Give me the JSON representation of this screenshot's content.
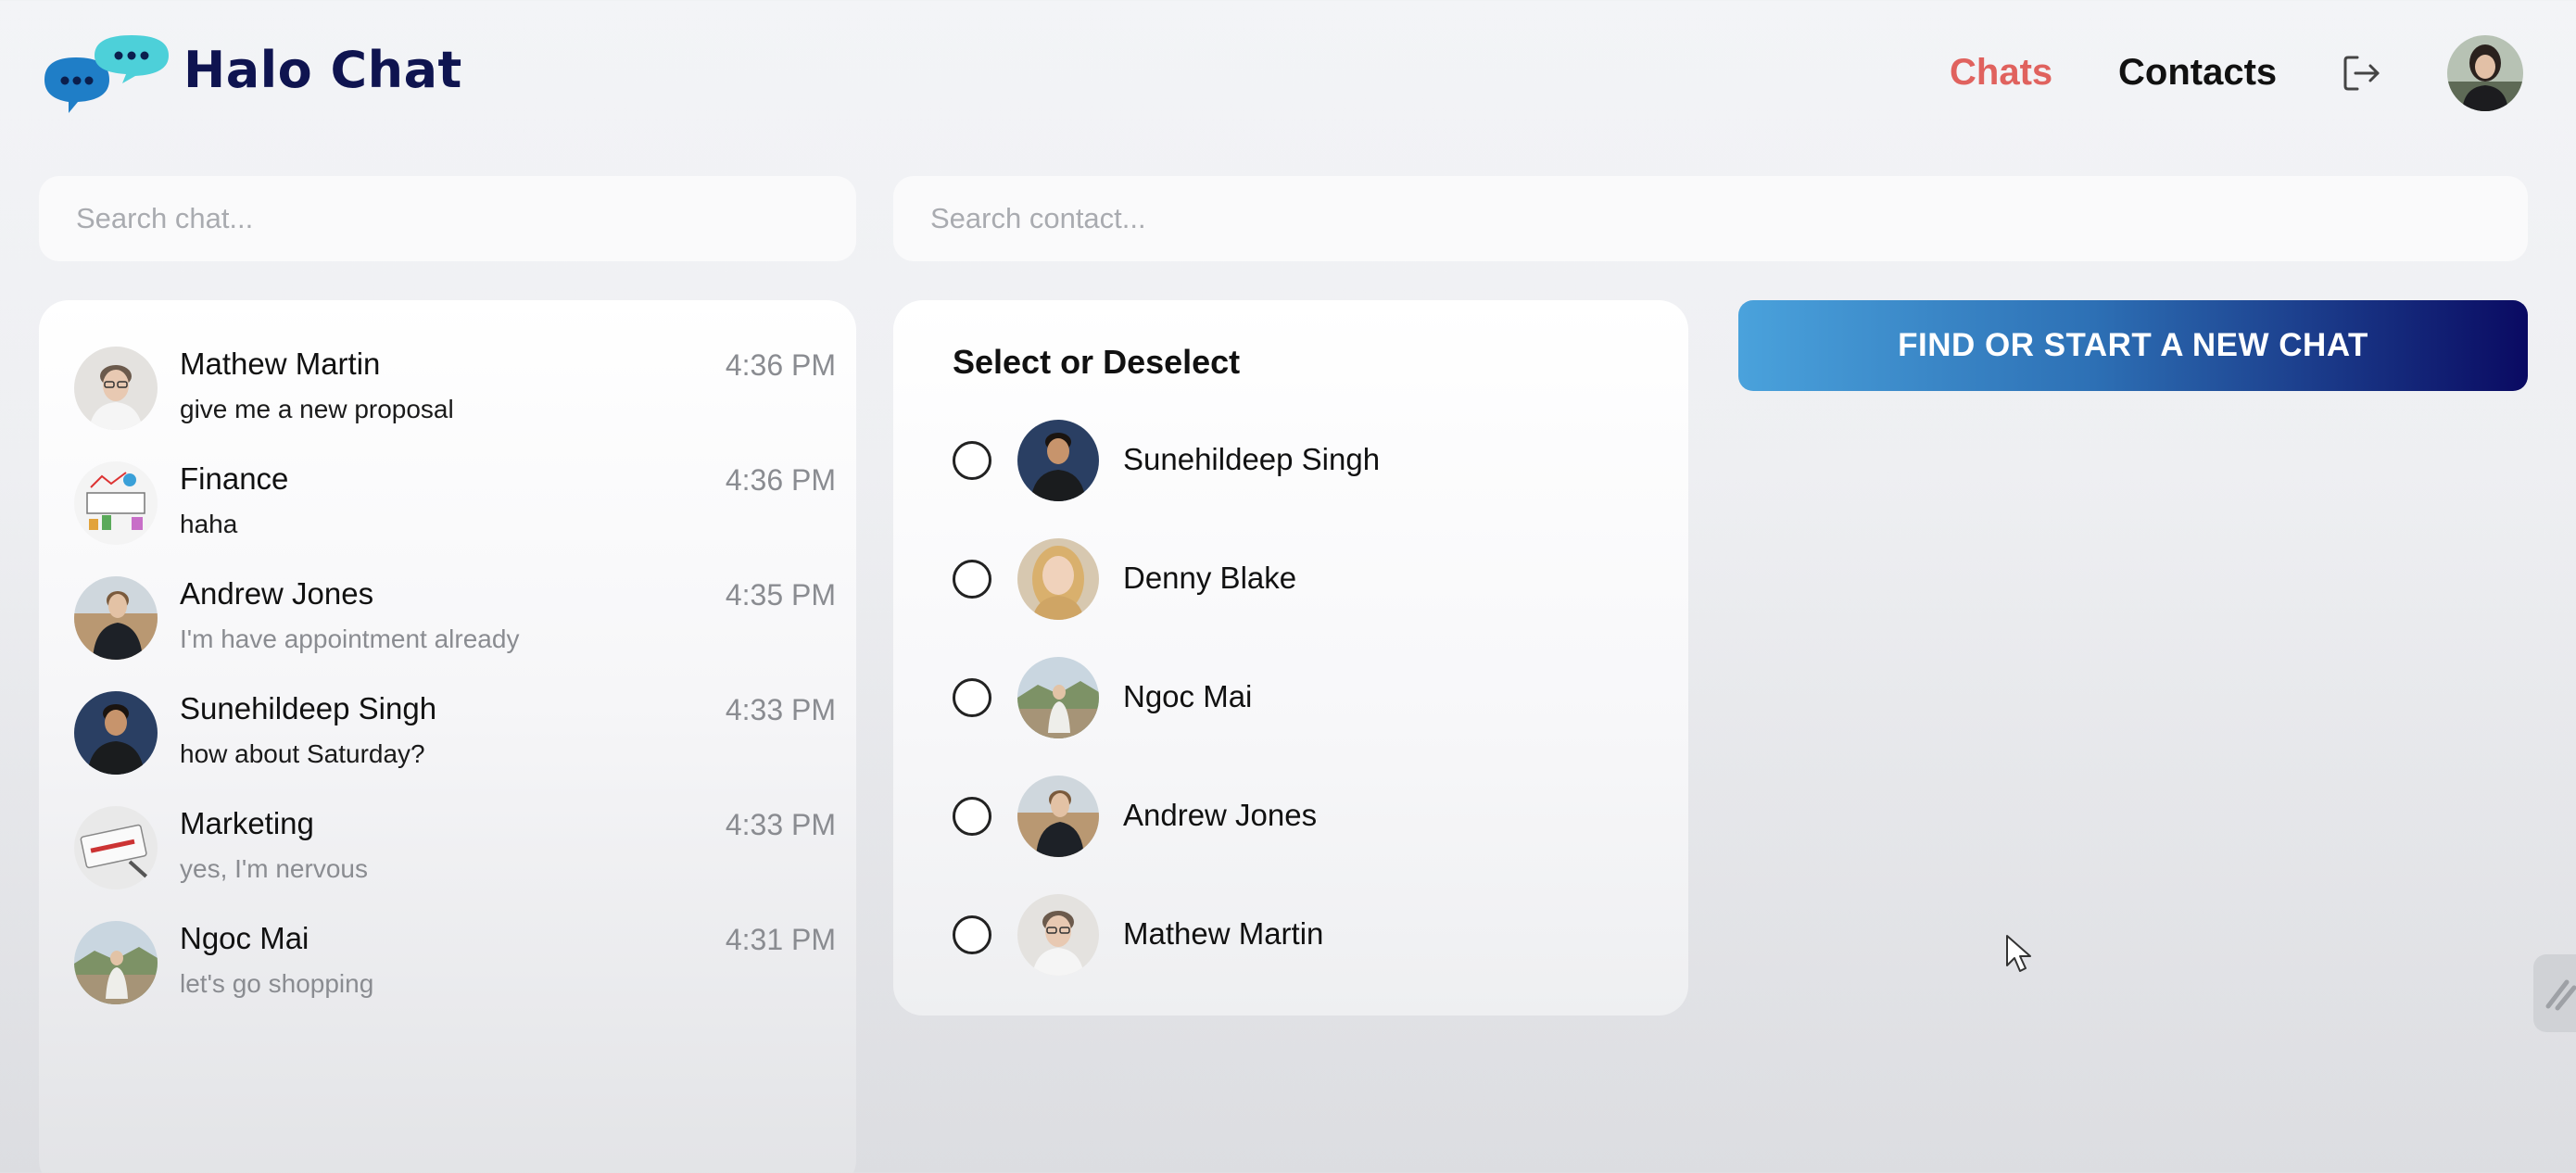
{
  "header": {
    "app_title": "Halo Chat",
    "nav": {
      "chats_label": "Chats",
      "contacts_label": "Contacts"
    },
    "icons": {
      "logo": "chat-bubbles-logo-icon",
      "logout": "logout-icon"
    }
  },
  "search": {
    "chat_placeholder": "Search chat...",
    "contact_placeholder": "Search contact..."
  },
  "chats": [
    {
      "name": "Mathew Martin",
      "message": "give me a new proposal",
      "time": "4:36 PM"
    },
    {
      "name": "Finance",
      "message": "haha",
      "time": "4:36 PM"
    },
    {
      "name": "Andrew Jones",
      "message": "I'm have appointment already",
      "time": "4:35 PM"
    },
    {
      "name": "Sunehildeep Singh",
      "message": "how about Saturday?",
      "time": "4:33 PM"
    },
    {
      "name": "Marketing",
      "message": "yes, I'm nervous",
      "time": "4:33 PM"
    },
    {
      "name": "Ngoc Mai",
      "message": "let's go shopping",
      "time": "4:31 PM"
    }
  ],
  "contacts": {
    "title": "Select or Deselect",
    "items": [
      {
        "name": "Sunehildeep Singh"
      },
      {
        "name": "Denny Blake"
      },
      {
        "name": "Ngoc Mai"
      },
      {
        "name": "Andrew Jones"
      },
      {
        "name": "Mathew Martin"
      }
    ]
  },
  "actions": {
    "new_chat_label": "FIND OR START A NEW CHAT"
  },
  "colors": {
    "accent_red": "#e0625e",
    "brand_navy": "#0f1450",
    "button_start": "#4aa2dc",
    "button_end": "#0a0a62"
  }
}
